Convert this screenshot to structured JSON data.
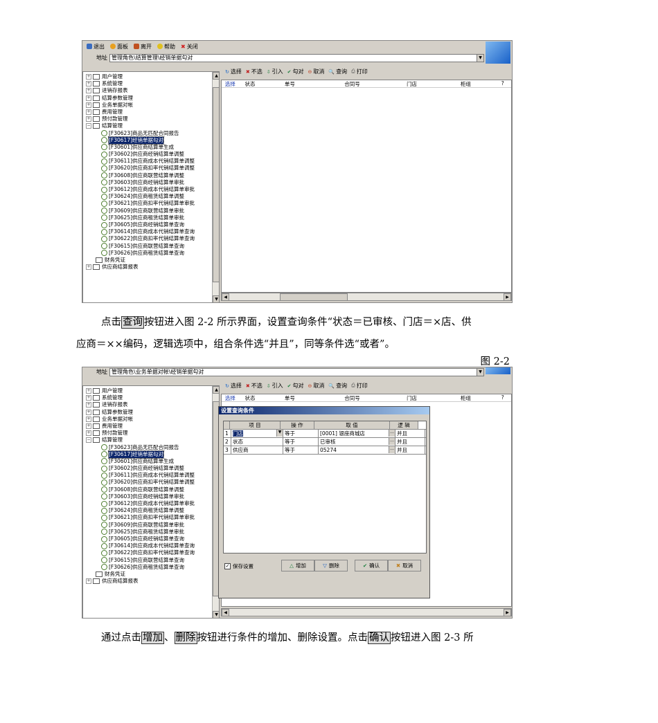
{
  "screenshot1": {
    "toolbar": {
      "exit": "退出",
      "panel": "面板",
      "detach": "离开",
      "help": "帮助",
      "close": "关闭"
    },
    "address_label": "地址",
    "address_value": "管理角色\\结算管理\\经销单据勾对",
    "actions": [
      "选择",
      "不选",
      "引入",
      "勾对",
      "取消",
      "查询",
      "打印"
    ],
    "grid_headers": [
      "选择",
      "状态",
      "单号",
      "合同号",
      "门店",
      "柜组",
      "?"
    ],
    "tree": [
      {
        "type": "folder",
        "label": "用户管理"
      },
      {
        "type": "folder",
        "label": "系统管理"
      },
      {
        "type": "folder",
        "label": "进销存报表"
      },
      {
        "type": "folder",
        "label": "结算参数管理"
      },
      {
        "type": "folder",
        "label": "业务单据对帐"
      },
      {
        "type": "folder",
        "label": "费用管理"
      },
      {
        "type": "folder",
        "label": "预付款管理"
      },
      {
        "type": "folder-open",
        "label": "结算管理"
      },
      {
        "type": "leaf",
        "label": "[F30623]商品无匹配合同报告"
      },
      {
        "type": "leaf",
        "label": "[F30617]经销单据勾对",
        "selected": true
      },
      {
        "type": "leaf",
        "label": "[F30601]供应商结算单生成"
      },
      {
        "type": "leaf",
        "label": "[F30602]供应商经销结算单调整"
      },
      {
        "type": "leaf",
        "label": "[F30611]供应商成本代销结算单调整"
      },
      {
        "type": "leaf",
        "label": "[F30620]供应商扣率代销结算单调整"
      },
      {
        "type": "leaf",
        "label": "[F30608]供应商联营结算单调整"
      },
      {
        "type": "leaf",
        "label": "[F30603]供应商经销结算单审批"
      },
      {
        "type": "leaf",
        "label": "[F30612]供应商成本代销结算单审批"
      },
      {
        "type": "leaf",
        "label": "[F30624]供应商租赁结算单调整"
      },
      {
        "type": "leaf",
        "label": "[F30621]供应商扣率代销结算单审批"
      },
      {
        "type": "leaf",
        "label": "[F30609]供应商联营结算单审批"
      },
      {
        "type": "leaf",
        "label": "[F30625]供应商租赁结算单审批"
      },
      {
        "type": "leaf",
        "label": "[F30605]供应商经销结算单查询"
      },
      {
        "type": "leaf",
        "label": "[F30614]供应商成本代销结算单查询"
      },
      {
        "type": "leaf",
        "label": "[F30622]供应商扣率代销结算单查询"
      },
      {
        "type": "leaf",
        "label": "[F30615]供应商联营结算单查询"
      },
      {
        "type": "leaf",
        "label": "[F30626]供应商租赁结算单查询"
      },
      {
        "type": "folder",
        "label": "财务凭证"
      },
      {
        "type": "folder",
        "label": "供应商结算报表"
      }
    ]
  },
  "para1": {
    "line1_a": "点击",
    "line1_btn": "查询",
    "line1_b": "按钮进入图 2-2 所示界面，设置查询条件“状态＝已审核、门店＝×店、供",
    "line2": "应商＝××编码，逻辑选项中，组合条件选“并且”，同等条件选“或者”。"
  },
  "fig_label": "图 2-2",
  "screenshot2": {
    "address_label": "地址",
    "address_value": "管理角色\\业务单据对帐\\经销单据勾对",
    "actions": [
      "选择",
      "不选",
      "引入",
      "勾对",
      "取消",
      "查询",
      "打印"
    ],
    "grid_headers": [
      "选择",
      "状态",
      "单号",
      "合同号",
      "门店",
      "柜组",
      "?"
    ],
    "tree": [
      {
        "type": "folder",
        "label": "用户管理"
      },
      {
        "type": "folder",
        "label": "系统管理"
      },
      {
        "type": "folder",
        "label": "进销存报表"
      },
      {
        "type": "folder",
        "label": "结算参数管理"
      },
      {
        "type": "folder",
        "label": "业务单据对帐"
      },
      {
        "type": "folder",
        "label": "费用管理"
      },
      {
        "type": "folder",
        "label": "预付款管理"
      },
      {
        "type": "folder-open",
        "label": "结算管理"
      },
      {
        "type": "leaf",
        "label": "[F30623]商品无匹配合同报告"
      },
      {
        "type": "leaf",
        "label": "[F30617]经销单据勾对",
        "selected": true
      },
      {
        "type": "leaf",
        "label": "[F30601]供应商结算单生成"
      },
      {
        "type": "leaf",
        "label": "[F30602]供应商经销结算单调整"
      },
      {
        "type": "leaf",
        "label": "[F30611]供应商成本代销结算单调整"
      },
      {
        "type": "leaf",
        "label": "[F30620]供应商扣率代销结算单调整"
      },
      {
        "type": "leaf",
        "label": "[F30608]供应商联营结算单调整"
      },
      {
        "type": "leaf",
        "label": "[F30603]供应商经销结算单审批"
      },
      {
        "type": "leaf",
        "label": "[F30612]供应商成本代销结算单审批"
      },
      {
        "type": "leaf",
        "label": "[F30624]供应商租赁结算单调整"
      },
      {
        "type": "leaf",
        "label": "[F30621]供应商扣率代销结算单审批"
      },
      {
        "type": "leaf",
        "label": "[F30609]供应商联营结算单审批"
      },
      {
        "type": "leaf",
        "label": "[F30625]供应商租赁结算单审批"
      },
      {
        "type": "leaf",
        "label": "[F30605]供应商经销结算单查询"
      },
      {
        "type": "leaf",
        "label": "[F30614]供应商成本代销结算单查询"
      },
      {
        "type": "leaf",
        "label": "[F30622]供应商扣率代销结算单查询"
      },
      {
        "type": "leaf",
        "label": "[F30615]供应商联营结算单查询"
      },
      {
        "type": "leaf",
        "label": "[F30626]供应商租赁结算单查询"
      },
      {
        "type": "folder",
        "label": "财务凭证"
      },
      {
        "type": "folder",
        "label": "供应商结算报表"
      }
    ],
    "dialog": {
      "title": "设置查询条件",
      "headers": [
        "项 目",
        "操 作",
        "取 值",
        "逻 辑"
      ],
      "rows": [
        {
          "n": "1",
          "item": "门店",
          "op": "等于",
          "val": "[0001] 银座商城店",
          "logic": "并且"
        },
        {
          "n": "2",
          "item": "状态",
          "op": "等于",
          "val": "已审核",
          "logic": "并且"
        },
        {
          "n": "3",
          "item": "供应商",
          "op": "等于",
          "val": "05274",
          "logic": "并且"
        }
      ],
      "save_label": "保存设置",
      "add": "增加",
      "delete": "删除",
      "ok": "确认",
      "cancel": "取消"
    }
  },
  "para2": {
    "a": "通过点击",
    "b1": "增加",
    "sep": "、",
    "b2": "删除",
    "c": "按钮进行条件的增加、删除设置。点击",
    "b3": "确认",
    "d": "按钮进入图 2-3 所"
  },
  "colors": {
    "selection": "#0a246a",
    "window": "#d4d0c8",
    "title_gradient_start": "#0a246a"
  }
}
